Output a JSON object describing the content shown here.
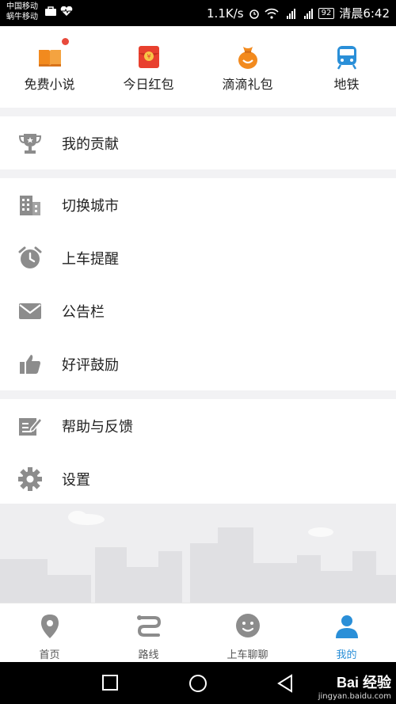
{
  "status_bar": {
    "carrier_1": "中国移动",
    "carrier_2": "蜗牛移动",
    "speed": "1.1K/s",
    "battery": "92",
    "time": "清晨6:42",
    "icons": [
      "briefcase-icon",
      "heart-rate-icon",
      "alarm-icon",
      "wifi-icon",
      "signal-4g-icon",
      "signal-2g-icon"
    ]
  },
  "quick_actions": [
    {
      "label": "免费小说",
      "icon": "book-icon",
      "badge": true
    },
    {
      "label": "今日红包",
      "icon": "red-envelope-icon"
    },
    {
      "label": "滴滴礼包",
      "icon": "gift-bag-icon"
    },
    {
      "label": "地铁",
      "icon": "subway-icon"
    }
  ],
  "menu": {
    "contribution": "我的贡献",
    "switch_city": "切换城市",
    "ride_reminder": "上车提醒",
    "bulletin": "公告栏",
    "rate": "好评鼓励",
    "help_feedback": "帮助与反馈",
    "settings": "设置"
  },
  "tabs": [
    {
      "label": "首页",
      "icon": "location-pin-icon"
    },
    {
      "label": "路线",
      "icon": "route-icon"
    },
    {
      "label": "上车聊聊",
      "icon": "chat-face-icon"
    },
    {
      "label": "我的",
      "icon": "user-icon",
      "active": true
    }
  ],
  "watermark": {
    "brand": "Bai 经验",
    "url": "jingyan.baidu.com"
  },
  "colors": {
    "accent": "#2a8fd8",
    "orange": "#f28a1e",
    "red": "#e84a3c",
    "icon_gray": "#8c8c8c"
  }
}
